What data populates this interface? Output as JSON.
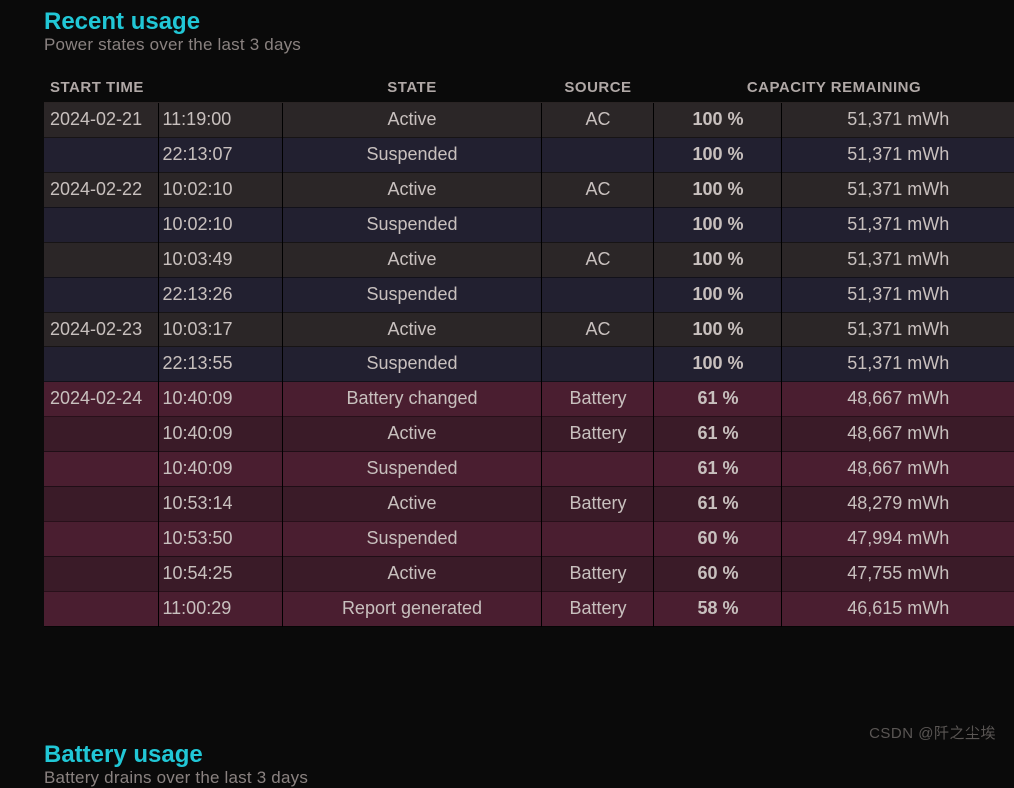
{
  "recent": {
    "title": "Recent usage",
    "subtitle": "Power states over the last 3 days",
    "columns": {
      "start": "START TIME",
      "state": "STATE",
      "source": "SOURCE",
      "capacity": "CAPACITY REMAINING"
    },
    "rows": [
      {
        "date": "2024-02-21",
        "time": "11:19:00",
        "state": "Active",
        "source": "AC",
        "pct": "100 %",
        "mwh": "51,371 mWh",
        "src": "ac"
      },
      {
        "date": "",
        "time": "22:13:07",
        "state": "Suspended",
        "source": "",
        "pct": "100 %",
        "mwh": "51,371 mWh",
        "src": "ac"
      },
      {
        "date": "2024-02-22",
        "time": "10:02:10",
        "state": "Active",
        "source": "AC",
        "pct": "100 %",
        "mwh": "51,371 mWh",
        "src": "ac"
      },
      {
        "date": "",
        "time": "10:02:10",
        "state": "Suspended",
        "source": "",
        "pct": "100 %",
        "mwh": "51,371 mWh",
        "src": "ac"
      },
      {
        "date": "",
        "time": "10:03:49",
        "state": "Active",
        "source": "AC",
        "pct": "100 %",
        "mwh": "51,371 mWh",
        "src": "ac"
      },
      {
        "date": "",
        "time": "22:13:26",
        "state": "Suspended",
        "source": "",
        "pct": "100 %",
        "mwh": "51,371 mWh",
        "src": "ac"
      },
      {
        "date": "2024-02-23",
        "time": "10:03:17",
        "state": "Active",
        "source": "AC",
        "pct": "100 %",
        "mwh": "51,371 mWh",
        "src": "ac"
      },
      {
        "date": "",
        "time": "22:13:55",
        "state": "Suspended",
        "source": "",
        "pct": "100 %",
        "mwh": "51,371 mWh",
        "src": "ac"
      },
      {
        "date": "2024-02-24",
        "time": "10:40:09",
        "state": "Battery changed",
        "source": "Battery",
        "pct": "61 %",
        "mwh": "48,667 mWh",
        "src": "batt"
      },
      {
        "date": "",
        "time": "10:40:09",
        "state": "Active",
        "source": "Battery",
        "pct": "61 %",
        "mwh": "48,667 mWh",
        "src": "batt"
      },
      {
        "date": "",
        "time": "10:40:09",
        "state": "Suspended",
        "source": "",
        "pct": "61 %",
        "mwh": "48,667 mWh",
        "src": "batt"
      },
      {
        "date": "",
        "time": "10:53:14",
        "state": "Active",
        "source": "Battery",
        "pct": "61 %",
        "mwh": "48,279 mWh",
        "src": "batt"
      },
      {
        "date": "",
        "time": "10:53:50",
        "state": "Suspended",
        "source": "",
        "pct": "60 %",
        "mwh": "47,994 mWh",
        "src": "batt"
      },
      {
        "date": "",
        "time": "10:54:25",
        "state": "Active",
        "source": "Battery",
        "pct": "60 %",
        "mwh": "47,755 mWh",
        "src": "batt"
      },
      {
        "date": "",
        "time": "11:00:29",
        "state": "Report generated",
        "source": "Battery",
        "pct": "58 %",
        "mwh": "46,615 mWh",
        "src": "batt"
      }
    ]
  },
  "battery": {
    "title": "Battery usage",
    "subtitle": "Battery drains over the last 3 days"
  },
  "watermark": "CSDN @阡之尘埃"
}
